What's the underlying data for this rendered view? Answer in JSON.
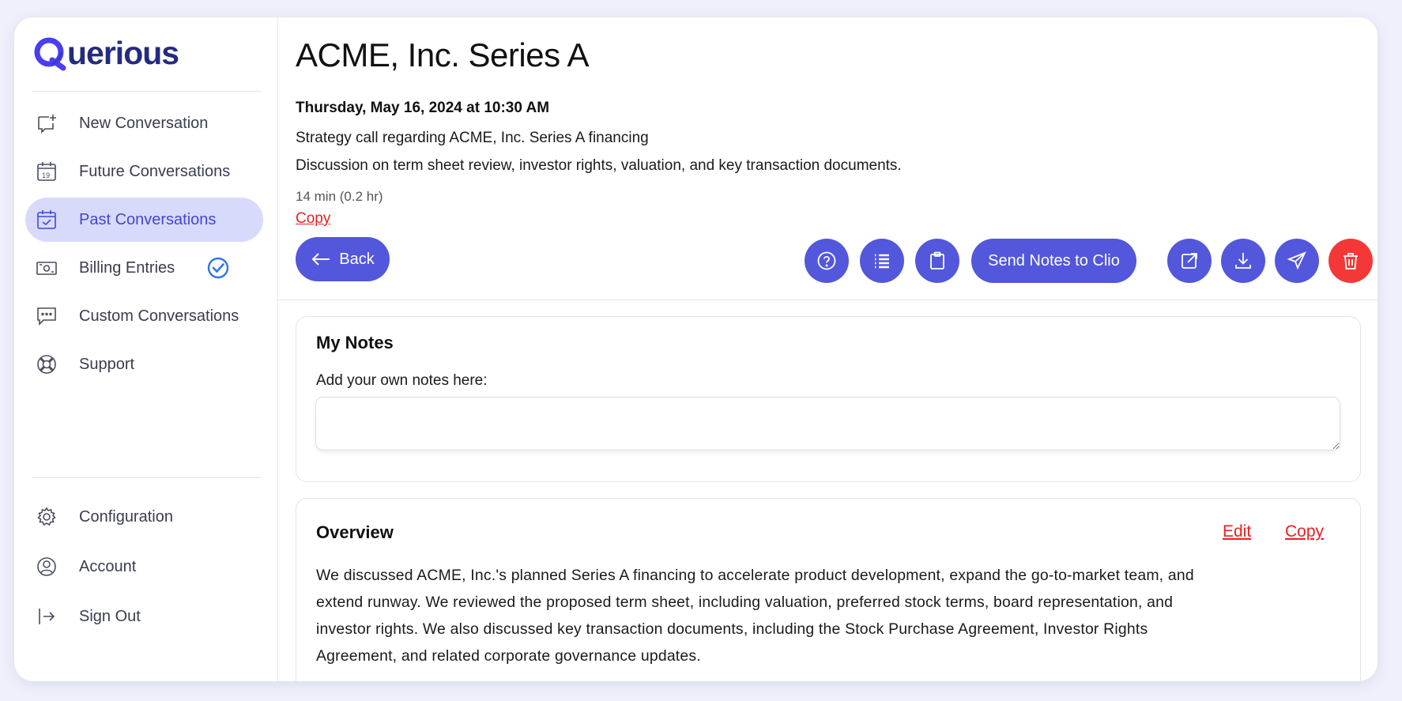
{
  "brand": {
    "name": "uerious",
    "accent": "#5257db",
    "logo_color": "#242b80"
  },
  "sidebar": {
    "items": [
      {
        "label": "New Conversation",
        "icon": "new-chat-icon"
      },
      {
        "label": "Future Conversations",
        "icon": "calendar-icon"
      },
      {
        "label": "Past Conversations",
        "icon": "calendar-check-icon",
        "active": true
      },
      {
        "label": "Billing Entries",
        "icon": "money-icon",
        "badge": "check-circle-icon"
      },
      {
        "label": "Custom Conversations",
        "icon": "chat-dots-icon"
      },
      {
        "label": "Support",
        "icon": "lifebuoy-icon"
      }
    ],
    "bottom_items": [
      {
        "label": "Configuration",
        "icon": "gear-icon"
      },
      {
        "label": "Account",
        "icon": "user-circle-icon"
      },
      {
        "label": "Sign Out",
        "icon": "sign-out-icon"
      }
    ]
  },
  "header": {
    "title": "ACME, Inc. Series A",
    "datetime": "Thursday, May 16, 2024 at 10:30 AM",
    "summary": "Strategy call regarding ACME, Inc. Series A financing",
    "description": "Discussion on term sheet review, investor rights, valuation, and key transaction documents.",
    "duration": "14 min (0.2 hr)",
    "copy_label": "Copy"
  },
  "toolbar": {
    "back_label": "Back",
    "send_label": "Send Notes to Clio",
    "icons": [
      "help-icon",
      "list-icon",
      "clipboard-icon",
      "external-edit-icon",
      "download-icon",
      "send-icon",
      "trash-icon"
    ]
  },
  "notes": {
    "title": "My Notes",
    "label": "Add your own notes here:",
    "value": ""
  },
  "overview": {
    "title": "Overview",
    "edit_label": "Edit",
    "copy_label": "Copy",
    "text": "We discussed ACME, Inc.'s planned Series A financing to accelerate product development, expand the go-to-market team, and extend runway. We reviewed the proposed term sheet, including valuation, preferred stock terms, board representation, and investor rights. We also discussed key transaction documents, including the Stock Purchase Agreement, Investor Rights Agreement, and related corporate governance updates."
  }
}
